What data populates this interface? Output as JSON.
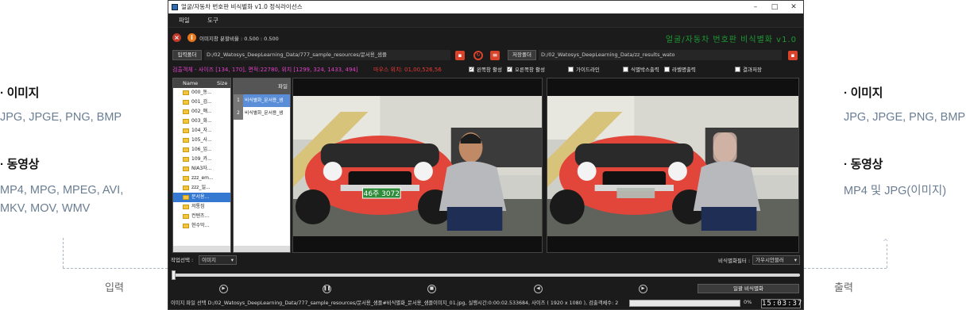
{
  "left_panel": {
    "image_heading": "· 이미지",
    "image_formats": "JPG, JPGE, PNG, BMP",
    "video_heading": "· 동영상",
    "video_formats_line1": "MP4, MPG, MPEG, AVI,",
    "video_formats_line2": "MKV, MOV, WMV",
    "flow_label": "입력"
  },
  "right_panel": {
    "image_heading": "· 이미지",
    "image_formats": "JPG, JPGE, PNG, BMP",
    "video_heading": "· 동영상",
    "video_formats": "MP4 및 JPG(이미지)",
    "flow_label": "출력"
  },
  "window": {
    "title": "얼굴/자동차 번호판 비식별화  v1.0 정식라이선스",
    "menu": [
      "파일",
      "도구"
    ],
    "split_ratio_label": "이미지창 분할비율 : 0.500 : 0.500",
    "brand_title": "얼굴/자동차 번호판 비식별화 v1.0",
    "input_folder_button": "입력폴더",
    "input_path": "D:/02_Watosys_DeepLearning_Data/777_sample_resources/문서용_샘플",
    "save_folder_button": "저장폴더",
    "save_path": "D:/02_Watosys_DeepLearning_Data/zz_results_wato",
    "detect_info": "검출객체 - 사이즈 [134, 170], 면적:22780, 위치 [1299, 324, 1433, 494]",
    "mouse_pos": "마우스 위치: 01,00,526,56",
    "checkboxes": [
      {
        "label": "왼쪽창 활성",
        "checked": true
      },
      {
        "label": "오른쪽창 활성",
        "checked": true
      },
      {
        "label": "가이드라인",
        "checked": false
      },
      {
        "label": "식별박스출력",
        "checked": false
      },
      {
        "label": "라벨명출력",
        "checked": false
      },
      {
        "label": "결과저장",
        "checked": false
      }
    ],
    "tree_header_name": "Name",
    "tree_header_size": "Size",
    "tree_items": [
      "000_동...",
      "001_검...",
      "002_얘...",
      "003_화...",
      "104_자...",
      "105_사...",
      "106_임...",
      "109_카...",
      "NIA3자...",
      "zzz_em...",
      "zzz_일...",
      "문서용...",
      "저통짐",
      "컨텐츠...",
      "현수막..."
    ],
    "tree_selected_index": 11,
    "file_list_header": "파일",
    "files": [
      {
        "num": "1",
        "name": "비식별화_문서용_샘"
      },
      {
        "num": "2",
        "name": "비식별화_문서용_샘"
      }
    ],
    "plate_text": "46주 3072",
    "task_select_label": "작업선택 :",
    "task_select_value": "이미지",
    "filter_label": "비식별화필터 :",
    "filter_value": "가우시안블러",
    "batch_button": "일괄 비식별화",
    "status_text": "이미지 파일 선택 D:/02_Watosys_DeepLearning_Data/777_sample_resources/문서용_샘플#비식별화_문서용_샘플이미지_01.jpg,  실행시간:0:00:02.533684, 사이즈 ( 1920 x 1080 ), 검출객체수: 2",
    "progress_text": "0%",
    "clock": "15:03:37",
    "progress_value": 0
  },
  "colors": {
    "brand_green": "#1d9a34",
    "detect_magenta": "#e040c8",
    "mouse_red": "#e53935",
    "car_red": "#e2463a",
    "selection_blue": "#3478d2"
  }
}
